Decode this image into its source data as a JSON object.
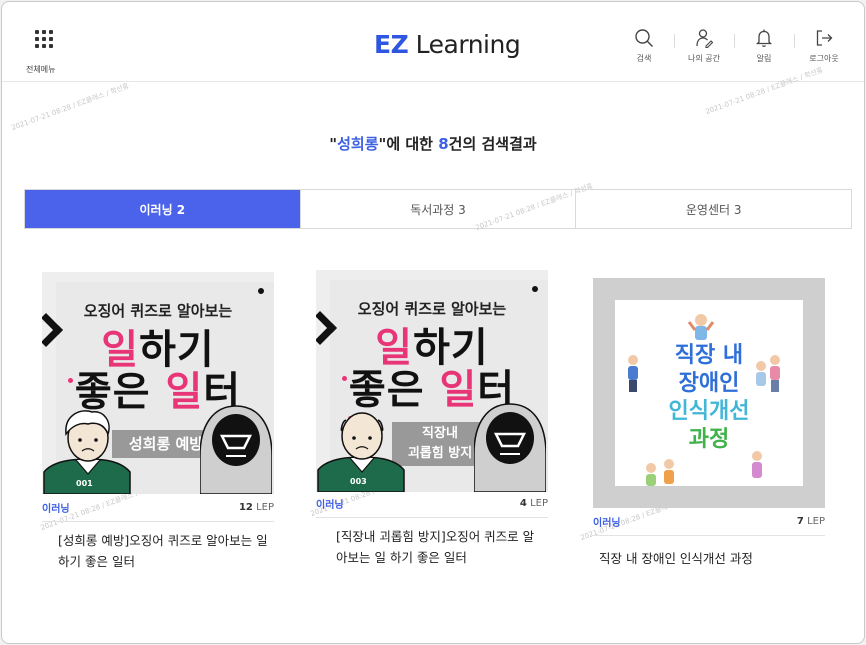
{
  "header": {
    "menu_label": "전체메뉴",
    "logo_ez": "EZ",
    "logo_rest": " Learning",
    "icons": [
      {
        "icon": "search-icon",
        "label": "검색"
      },
      {
        "icon": "my-space-icon",
        "label": "나의 공간"
      },
      {
        "icon": "bell-icon",
        "label": "알림"
      },
      {
        "icon": "logout-icon",
        "label": "로그아웃"
      }
    ]
  },
  "watermark": "2021-07-21 08:28 / EZ클래스 / 학선홍",
  "search": {
    "quote_open": "\"",
    "keyword": "성희롱",
    "quote_close": "\"",
    "middle": "에 대한 ",
    "count": "8",
    "suffix": "건의 검색결과"
  },
  "tabs": [
    {
      "label": "이러닝 2",
      "active": true
    },
    {
      "label": "독서과정 3",
      "active": false
    },
    {
      "label": "운영센터 3",
      "active": false
    }
  ],
  "cards": [
    {
      "thumb": {
        "line1": "오징어 퀴즈로 알아보는",
        "line2a_pink": "일",
        "line2b": "하기",
        "line3a": "좋은 ",
        "line3b_pink": "일",
        "line3c": "터",
        "badge": "성희롱 예방",
        "number": "001"
      },
      "category": "이러닝",
      "lep_value": "12",
      "lep_unit": "LEP",
      "title": "[성희롱 예방]오징어 퀴즈로 알아보는 일 하기 좋은 일터"
    },
    {
      "thumb": {
        "line1": "오징어 퀴즈로 알아보는",
        "line2a_pink": "일",
        "line2b": "하기",
        "line3a": "좋은 ",
        "line3b_pink": "일",
        "line3c": "터",
        "badge_line1": "직장내",
        "badge_line2": "괴롭힘 방지",
        "number": "003"
      },
      "category": "이러닝",
      "lep_value": "4",
      "lep_unit": "LEP",
      "title": "[직장내 괴롭힘 방지]오징어 퀴즈로 알아보는 일 하기 좋은 일터"
    },
    {
      "thumb": {
        "line1": "직장 내",
        "line2": "장애인",
        "line3": "인식개선",
        "line4": "과정"
      },
      "category": "이러닝",
      "lep_value": "7",
      "lep_unit": "LEP",
      "title": "직장 내 장애인 인식개선 과정"
    }
  ]
}
